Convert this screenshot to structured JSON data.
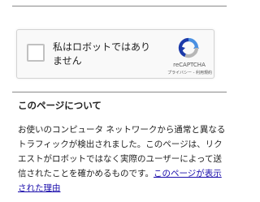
{
  "captcha": {
    "checkbox_label": "私はロボットではありません",
    "brand": "reCAPTCHA",
    "privacy_link": "プライバシー",
    "separator": " - ",
    "terms_link": "利用規約",
    "logo_icon": "recaptcha-logo-icon",
    "logo_colors": {
      "blue": "#4a90e2",
      "dark_blue": "#1c3aa9",
      "gray": "#b7b7b7"
    },
    "checked": false
  },
  "about": {
    "heading": "このページについて",
    "paragraph": "お使いのコンピュータ ネットワークから通常と異なるトラフィックが検出されました。このページは、リクエストがロボットではなく実際のユーザーによって送信されたことを確かめるものです。",
    "link": "このページが表示された理由"
  },
  "colors": {
    "link": "#1a0dab",
    "rule": "#8a8a8a"
  }
}
